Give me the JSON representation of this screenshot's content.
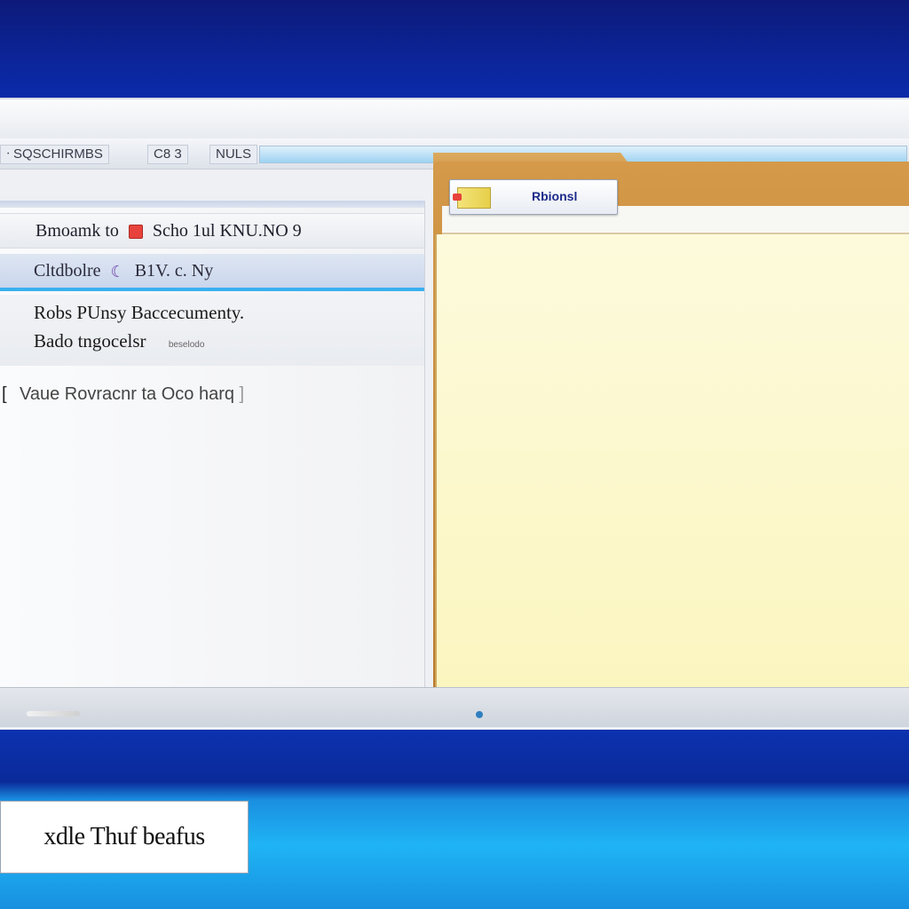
{
  "window": {
    "title": "",
    "toolbar": {
      "segments": [
        "ᐧ SQSCHIRMBS",
        "C8 3",
        "NULS"
      ]
    }
  },
  "list": {
    "row1": {
      "left": "Bmoamk to",
      "right": "Scho 1ul KNU.NO 9"
    },
    "row2": {
      "left": "Cltdbolre",
      "right": "B1V. c. Ny"
    },
    "group": {
      "line1": "Robs PUnsy Baccecumenty.",
      "line2": "Bado tngocelsr",
      "line2_small": "beselodo"
    },
    "row3": {
      "text": "Vaue Rovracnr ta Oco harq"
    }
  },
  "folder": {
    "label": "Rbionsl"
  },
  "taskbar": {
    "label": "xdle Thuf beafus"
  },
  "colors": {
    "desktop": "#0b2aa8",
    "taskbar": "#1fb4f5",
    "selection_accent": "#3ab0f0",
    "folder_paper": "#fbf6c0",
    "folder_manila": "#c98a38"
  }
}
